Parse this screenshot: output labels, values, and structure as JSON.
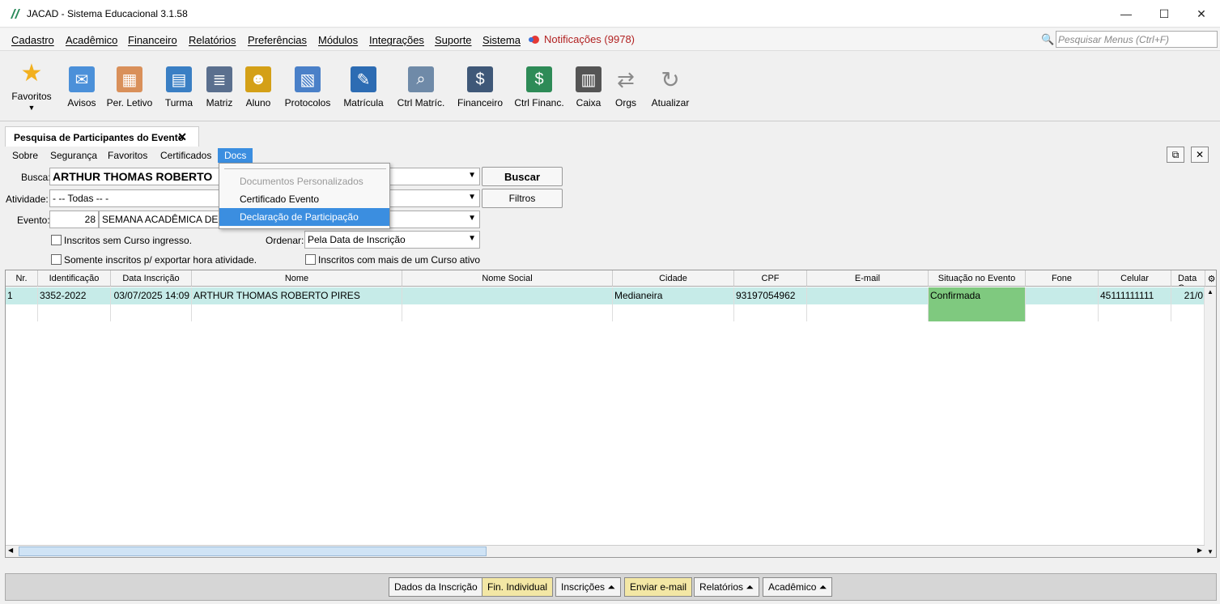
{
  "window": {
    "title": "JACAD - Sistema Educacional 3.1.58",
    "minimize": "—",
    "maximize": "☐",
    "close": "✕"
  },
  "menu": {
    "items": [
      "Cadastro",
      "Acadêmico",
      "Financeiro",
      "Relatórios",
      "Preferências",
      "Módulos",
      "Integrações",
      "Suporte",
      "Sistema"
    ],
    "notifications": "Notificações (9978)",
    "search_placeholder": "Pesquisar Menus (Ctrl+F)"
  },
  "toolbar": [
    {
      "label": "Favoritos",
      "icon": "star-icon",
      "color": "#f2b01e"
    },
    {
      "label": "Avisos",
      "icon": "envelope-icon",
      "color": "#4b90d9"
    },
    {
      "label": "Per. Letivo",
      "icon": "calendar-icon",
      "color": "#d9905a"
    },
    {
      "label": "Turma",
      "icon": "classroom-icon",
      "color": "#3a7fc4"
    },
    {
      "label": "Matriz",
      "icon": "matrix-icon",
      "color": "#5a6f8e"
    },
    {
      "label": "Aluno",
      "icon": "student-icon",
      "color": "#d4a017"
    },
    {
      "label": "Protocolos",
      "icon": "protocol-icon",
      "color": "#4a80c8"
    },
    {
      "label": "Matrícula",
      "icon": "enrollment-icon",
      "color": "#2d6cb3"
    },
    {
      "label": "Ctrl Matríc.",
      "icon": "control-enrollment-icon",
      "color": "#6f8aa8"
    },
    {
      "label": "Financeiro",
      "icon": "finance-icon",
      "color": "#3f5878"
    },
    {
      "label": "Ctrl Financ.",
      "icon": "finance-control-icon",
      "color": "#2e8b57"
    },
    {
      "label": "Caixa",
      "icon": "cash-register-icon",
      "color": "#555"
    },
    {
      "label": "Orgs",
      "icon": "orgs-icon",
      "color": "#8a8a8a"
    },
    {
      "label": "Atualizar",
      "icon": "refresh-icon",
      "color": "#8a8a8a"
    }
  ],
  "tab": {
    "title": "Pesquisa de Participantes do Evento",
    "close": "✕"
  },
  "submenu": {
    "items": [
      "Sobre",
      "Segurança",
      "Favoritos",
      "Certificados",
      "Docs"
    ]
  },
  "docs_menu": {
    "items": [
      "Documentos Personalizados",
      "Certificado Evento",
      "Declaração de Participação"
    ]
  },
  "form": {
    "busca_label": "Busca:",
    "busca_value": "ARTHUR THOMAS ROBERTO",
    "atividade_label": "Atividade:",
    "atividade_value": "- -- Todas -- -",
    "evento_label": "Evento:",
    "evento_id": "28",
    "evento_name": "SEMANA ACADÊMICA DE A",
    "chk_sem_curso": "Inscritos sem Curso ingresso.",
    "chk_exportar": "Somente inscritos p/ exportar hora atividade.",
    "ordenar_label": "Ordenar:",
    "ordenar_value": "Pela Data de Inscrição",
    "chk_mais_curso": "Inscritos com mais de um Curso ativo",
    "buscar": "Buscar",
    "filtros": "Filtros"
  },
  "grid": {
    "columns": [
      "Nr.",
      "Identificação",
      "Data Inscrição",
      "Nome",
      "Nome Social",
      "Cidade",
      "CPF",
      "E-mail",
      "Situação no Evento",
      "Fone",
      "Celular",
      "Data C"
    ],
    "rows": [
      [
        "1",
        "3352-2022",
        "03/07/2025 14:09",
        "ARTHUR THOMAS ROBERTO PIRES",
        "",
        "Medianeira",
        "93197054962",
        "",
        "Confirmada",
        "",
        "45111111111",
        "21/0"
      ]
    ]
  },
  "bottom": {
    "buttons": [
      "Dados da Inscrição",
      "Fin. Individual",
      "Inscrições ⏶",
      "Enviar e-mail",
      "Relatórios ⏶",
      "Acadêmico ⏶"
    ]
  }
}
